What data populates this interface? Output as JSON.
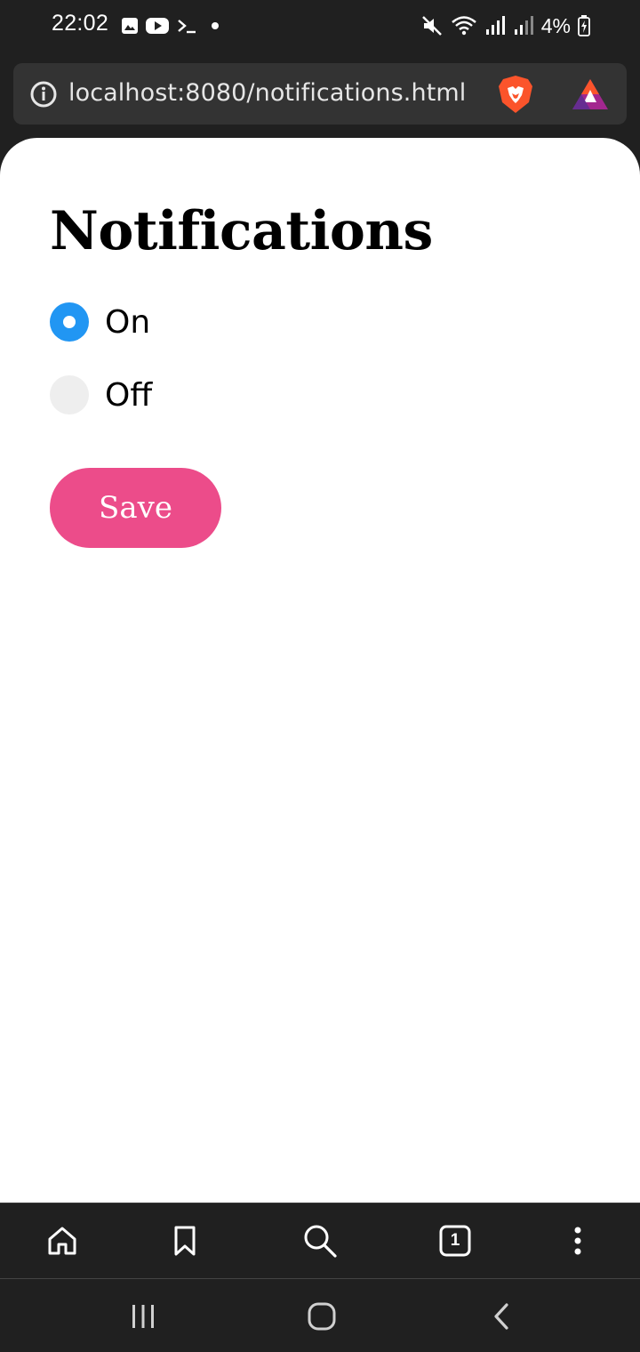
{
  "status_bar": {
    "time": "22:02",
    "battery": "4%",
    "left_icons": [
      "gallery-icon",
      "youtube-icon",
      "terminal-icon",
      "dot-icon"
    ],
    "right_icons": [
      "mute-icon",
      "wifi-icon",
      "signal-icon",
      "signal-icon",
      "battery-charging-icon"
    ]
  },
  "browser": {
    "url": "localhost:8080/notifications.html",
    "icons": [
      "info-icon",
      "brave-shield-icon",
      "brave-rewards-icon"
    ]
  },
  "page": {
    "title": "Notifications",
    "options": [
      {
        "label": "On",
        "checked": true
      },
      {
        "label": "Off",
        "checked": false
      }
    ],
    "save_label": "Save"
  },
  "toolbar": {
    "tab_count": "1",
    "icons": [
      "home-icon",
      "bookmark-icon",
      "search-icon",
      "tabs-icon",
      "menu-icon"
    ]
  },
  "nav": {
    "icons": [
      "recents-icon",
      "home-icon",
      "back-icon"
    ]
  },
  "colors": {
    "accent_radio": "#2196f3",
    "save_button": "#ec4c8a",
    "chrome_bg": "#202020"
  }
}
